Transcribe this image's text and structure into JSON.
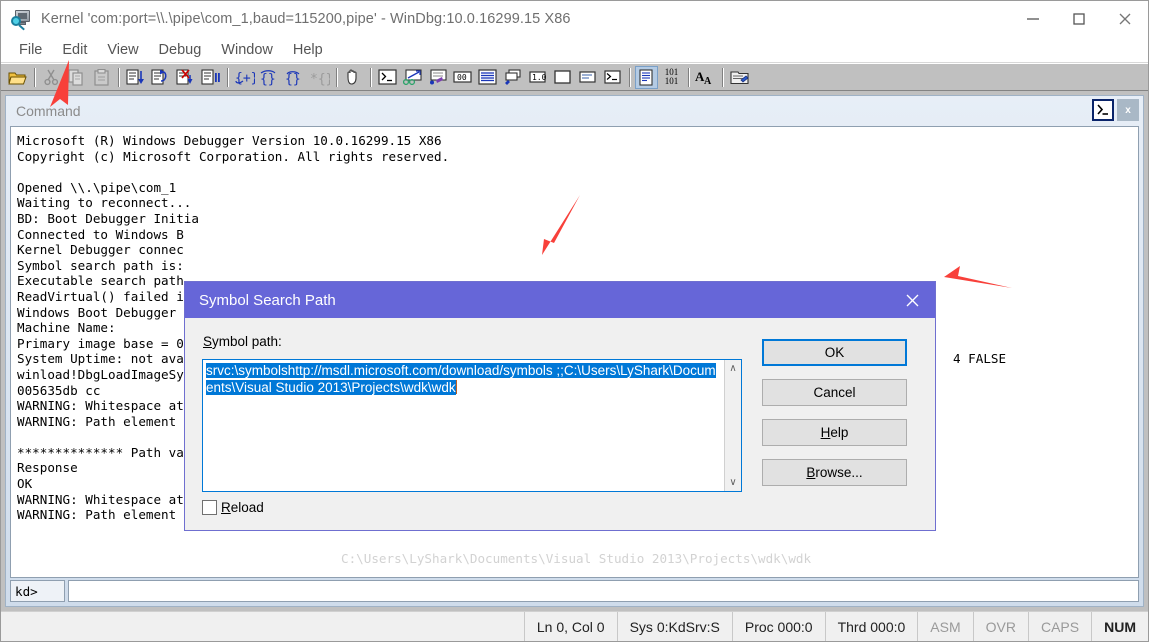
{
  "window": {
    "title": "Kernel 'com:port=\\\\.\\pipe\\com_1,baud=115200,pipe' - WinDbg:10.0.16299.15 X86",
    "icon": "windbg-icon",
    "minimize_label": "—",
    "maximize_label": "□",
    "close_label": "✕"
  },
  "menubar": {
    "items": [
      {
        "label": "File"
      },
      {
        "label": "Edit"
      },
      {
        "label": "View"
      },
      {
        "label": "Debug"
      },
      {
        "label": "Window"
      },
      {
        "label": "Help"
      }
    ]
  },
  "toolbar": {
    "items": [
      {
        "name": "open-folder-icon",
        "type": "icon"
      },
      {
        "name": "separator",
        "type": "sep"
      },
      {
        "name": "cut-icon",
        "type": "icon"
      },
      {
        "name": "copy-icon",
        "type": "icon"
      },
      {
        "name": "paste-icon",
        "type": "icon"
      },
      {
        "name": "separator",
        "type": "sep"
      },
      {
        "name": "step-into-icon",
        "type": "icon"
      },
      {
        "name": "step-over-icon",
        "type": "icon"
      },
      {
        "name": "run-to-cursor-icon",
        "type": "icon"
      },
      {
        "name": "break-icon",
        "type": "icon"
      },
      {
        "name": "separator",
        "type": "sep"
      },
      {
        "name": "trace-into-braces-icon",
        "type": "icon"
      },
      {
        "name": "step-over-braces-icon",
        "type": "icon"
      },
      {
        "name": "step-out-braces-icon",
        "type": "icon"
      },
      {
        "name": "trace-disabled-braces-icon",
        "type": "icon"
      },
      {
        "name": "separator",
        "type": "sep"
      },
      {
        "name": "hand-stop-icon",
        "type": "icon"
      },
      {
        "name": "separator",
        "type": "sep"
      },
      {
        "name": "command-window-icon",
        "type": "icon"
      },
      {
        "name": "watch-window-icon",
        "type": "icon"
      },
      {
        "name": "locals-window-icon",
        "type": "icon"
      },
      {
        "name": "registers-window-icon",
        "type": "icon"
      },
      {
        "name": "memory-window-icon",
        "type": "icon"
      },
      {
        "name": "call-stack-window-icon",
        "type": "icon"
      },
      {
        "name": "disassembly-window-icon",
        "type": "icon"
      },
      {
        "name": "scratch-pad-icon",
        "type": "icon"
      },
      {
        "name": "processes-threads-icon",
        "type": "icon"
      },
      {
        "name": "command-browser-icon",
        "type": "icon"
      },
      {
        "name": "separator",
        "type": "sep"
      },
      {
        "name": "source-mode-icon",
        "type": "icon",
        "active": true
      },
      {
        "name": "binary-101-icon",
        "type": "icon"
      },
      {
        "name": "separator",
        "type": "sep"
      },
      {
        "name": "font-size-icon",
        "type": "icon"
      },
      {
        "name": "separator",
        "type": "sep"
      },
      {
        "name": "open-source-file-icon",
        "type": "icon"
      }
    ]
  },
  "command_window": {
    "caption": "Command",
    "dock_button": "command-dock-icon",
    "close_button": "x",
    "output": "Microsoft (R) Windows Debugger Version 10.0.16299.15 X86\nCopyright (c) Microsoft Corporation. All rights reserved.\n\nOpened \\\\.\\pipe\\com_1\nWaiting to reconnect...\nBD: Boot Debugger Initia\nConnected to Windows B\nKernel Debugger connec\nSymbol search path is:\nExecutable search path\nReadVirtual() failed i\nWindows Boot Debugger\nMachine Name:\nPrimary image base = 0\nSystem Uptime: not ava\nwinload!DbgLoadImageSy\n005635db cc\nWARNING: Whitespace at\nWARNING: Path element\n\n************** Path val\nResponse\nOK\nWARNING: Whitespace at end of path element\nWARNING: Path element is empty",
    "right_fragment": "4 FALSE",
    "ghost_line": "C:\\Users\\LyShark\\Documents\\Visual Studio 2013\\Projects\\wdk\\wdk",
    "prompt_label": "kd>",
    "prompt_value": ""
  },
  "dialog": {
    "title": "Symbol Search Path",
    "close_label": "✕",
    "path_label_accel": "S",
    "path_label_rest": "ymbol path:",
    "path_value": "srvc:\\symbolshttp://msdl.microsoft.com/download/symbols ;;C:\\Users\\LyShark\\Documents\\Visual Studio 2013\\Projects\\wdk\\wdk",
    "scroll_up": "∧",
    "scroll_down": "∨",
    "reload_accel": "R",
    "reload_rest": "eload",
    "reload_checked": false,
    "buttons": [
      {
        "name": "ok-button",
        "label": "OK",
        "accel": "",
        "rest": "OK",
        "default": true
      },
      {
        "name": "cancel-button",
        "label": "Cancel",
        "accel": "",
        "rest": "Cancel",
        "default": false
      },
      {
        "name": "help-button",
        "label": "Help",
        "accel": "H",
        "rest": "elp",
        "default": false
      },
      {
        "name": "browse-button",
        "label": "Browse...",
        "accel": "B",
        "rest": "rowse...",
        "default": false
      }
    ]
  },
  "statusbar": {
    "cells": [
      {
        "label": "Ln 0, Col 0",
        "dim": false,
        "bold": false
      },
      {
        "label": "Sys 0:KdSrv:S",
        "dim": false,
        "bold": false
      },
      {
        "label": "Proc 000:0",
        "dim": false,
        "bold": false
      },
      {
        "label": "Thrd 000:0",
        "dim": false,
        "bold": false
      },
      {
        "label": "ASM",
        "dim": true,
        "bold": false
      },
      {
        "label": "OVR",
        "dim": true,
        "bold": false
      },
      {
        "label": "CAPS",
        "dim": true,
        "bold": false
      },
      {
        "label": "NUM",
        "dim": false,
        "bold": true
      }
    ]
  },
  "annotations": {
    "arrow_color": "#f8403a",
    "arrows": [
      {
        "name": "arrow-pointing-to-open-toolbar-button"
      },
      {
        "name": "arrow-pointing-to-symbol-path-field"
      },
      {
        "name": "arrow-pointing-to-ok-button"
      }
    ]
  },
  "colors": {
    "dialog_title_bg": "#6666d8",
    "selection_bg": "#0078d7",
    "toolbar_bg": "#c0c0c0",
    "arrow_red": "#f8403a"
  }
}
